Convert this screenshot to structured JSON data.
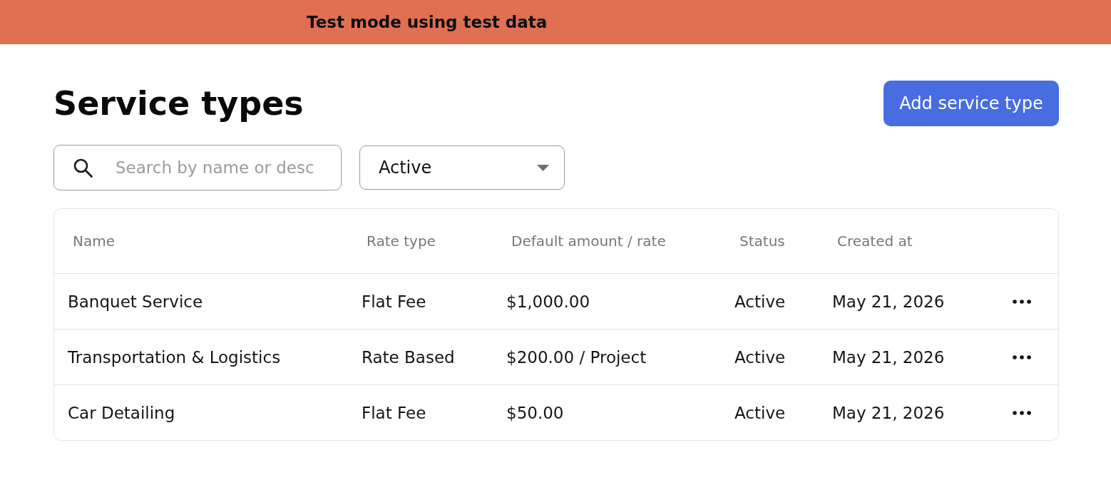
{
  "banner": {
    "text": "Test mode using test data"
  },
  "page": {
    "title": "Service types",
    "primary_button": "Add service type"
  },
  "filters": {
    "search": {
      "placeholder": "Search by name or desc"
    },
    "status_select": {
      "value": "Active"
    }
  },
  "table": {
    "columns": [
      "Name",
      "Rate type",
      "Default amount / rate",
      "Status",
      "Created at"
    ],
    "rows": [
      {
        "cells": [
          "Banquet Service",
          "Flat Fee",
          "$1,000.00",
          "Active",
          "May 21, 2026"
        ]
      },
      {
        "cells": [
          "Transportation & Logistics",
          "Rate Based",
          "$200.00 / Project",
          "Active",
          "May 21, 2026"
        ]
      },
      {
        "cells": [
          "Car Detailing",
          "Flat Fee",
          "$50.00",
          "Active",
          "May 21, 2026"
        ]
      }
    ]
  }
}
